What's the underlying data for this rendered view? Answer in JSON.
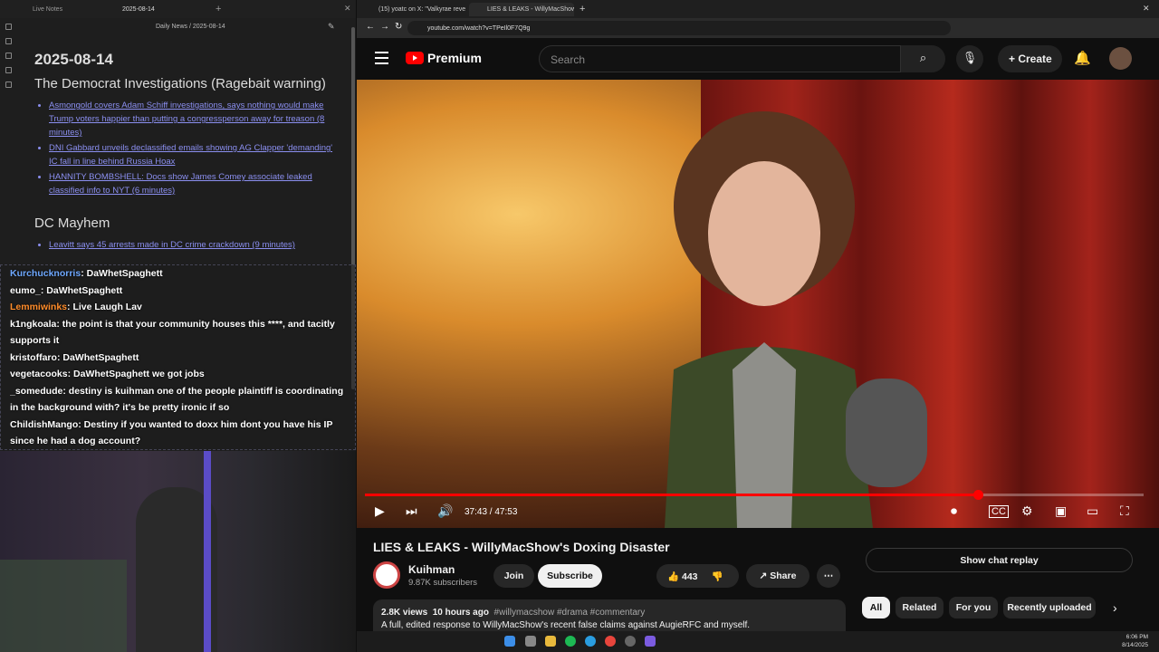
{
  "left_app": {
    "tabs": [
      "Live Notes",
      "2025-08-14"
    ],
    "breadcrumb": "Daily News / 2025-08-14",
    "note_title": "2025-08-14",
    "section1": {
      "heading": "The Democrat Investigations (Ragebait warning)",
      "items": [
        "Asmongold covers Adam Schiff investigations, says nothing would make Trump voters happier than putting a congressperson away for treason (8 minutes)",
        "DNI Gabbard unveils declassified emails showing AG Clapper 'demanding' IC fall in line behind Russia Hoax",
        "HANNITY BOMBSHELL: Docs show James Comey associate leaked classified info to NYT (6 minutes)"
      ]
    },
    "section2": {
      "heading": "DC Mayhem",
      "items": [
        "Leavitt says 45 arrests made in DC crime crackdown (9 minutes)"
      ]
    }
  },
  "chat": {
    "messages": [
      {
        "user": "Kurchucknorris",
        "text": "DaWhetSpaghett",
        "color": "#6ea8ff"
      },
      {
        "user": "eumo_",
        "text": "DaWhetSpaghett",
        "color": "#ffffff"
      },
      {
        "user": "Lemmiwinks",
        "text": "Live Laugh Lav",
        "color": "#ff8c2a"
      },
      {
        "user": "k1ngkoala",
        "text": "the point is that your community houses this ****, and tacitly supports it",
        "color": "#ffffff"
      },
      {
        "user": "kristoffaro",
        "text": "DaWhetSpaghett",
        "color": "#ffffff"
      },
      {
        "user": "vegetacooks",
        "text": "DaWhetSpaghett we got jobs",
        "color": "#ffffff"
      },
      {
        "user": "_somedude",
        "text": "destiny is kuihman one of the people plaintiff is coordinating in the background with? it's be pretty ironic if so",
        "color": "#ffffff"
      },
      {
        "user": "ChildishMango",
        "text": "Destiny if you wanted to doxx him dont you have his IP since he had a dog account?",
        "color": "#ffffff"
      }
    ]
  },
  "browser": {
    "tabs": [
      "(15) yoatc on X: \"Valkyrae reve...",
      "LIES & LEAKS - WillyMacShow..."
    ],
    "url": "youtube.com/watch?v=TPeIl0F7Q9g"
  },
  "youtube": {
    "logo_text": "Premium",
    "search_placeholder": "Search",
    "create_label": "Create",
    "player": {
      "time": "37:43 / 47:53",
      "progress": 0.787
    },
    "video_title": "LIES & LEAKS - WillyMacShow's Doxing Disaster",
    "channel_name": "Kuihman",
    "subscribers": "9.87K subscribers",
    "join_label": "Join",
    "subscribe_label": "Subscribe",
    "likes": "443",
    "share_label": "Share",
    "views": "2.8K views",
    "uploaded": "10 hours ago",
    "tags": "#willymacshow #drama #commentary",
    "description": "A full, edited response to WillyMacShow's recent false claims against AugieRFC and myself.",
    "chat_replay_label": "Show chat replay",
    "chips": [
      "All",
      "Related",
      "For you",
      "Recently uploaded"
    ]
  },
  "taskbar": {
    "time": "6:06 PM",
    "date": "8/14/2025"
  },
  "colors": {
    "yt_red": "#ff0000",
    "link": "#8b8ff0"
  }
}
